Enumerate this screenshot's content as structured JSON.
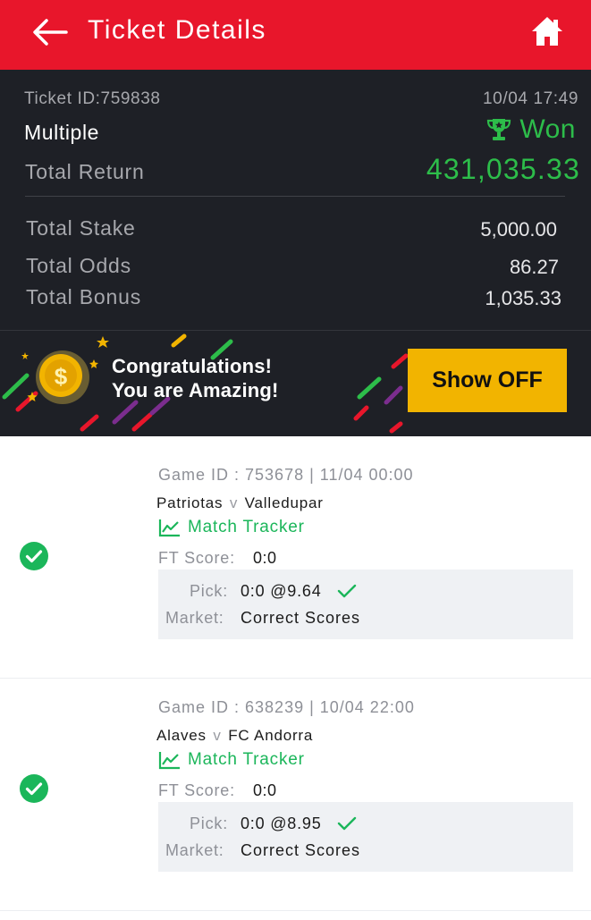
{
  "header": {
    "title": "Ticket Details",
    "back_icon": "arrow-left-icon",
    "home_icon": "home-icon",
    "background_color": "#e8162b"
  },
  "ticket": {
    "id_label": "Ticket ID:759838",
    "datetime": "10/04 17:49",
    "bet_type": "Multiple",
    "status": "Won",
    "status_icon": "trophy-icon",
    "status_color": "#2dbd4a",
    "total_return_label": "Total Return",
    "total_return": "431,035.33",
    "rows": [
      {
        "label": "Total Stake",
        "value": "5,000.00"
      },
      {
        "label": "Total Odds",
        "value": "86.27"
      },
      {
        "label": "Total Bonus",
        "value": "1,035.33"
      }
    ]
  },
  "banner": {
    "line1": "Congratulations!",
    "line2": "You are Amazing!",
    "coin_icon": "gold-coin-icon",
    "button_label": "Show OFF",
    "button_color": "#f2b400"
  },
  "games": [
    {
      "meta": "Game ID : 753678 | 11/04 00:00",
      "home": "Patriotas",
      "vs": "v",
      "away": "Valledupar",
      "tracker_label": "Match Tracker",
      "ft_label": "FT Score:",
      "ft_score": "0:0",
      "pick_label": "Pick:",
      "pick_value": "0:0 @9.64",
      "market_label": "Market:",
      "market_value": "Correct Scores",
      "result_icon": "check-circle-icon"
    },
    {
      "meta": "Game ID : 638239 | 10/04 22:00",
      "home": "Alaves",
      "vs": "v",
      "away": "FC Andorra",
      "tracker_label": "Match Tracker",
      "ft_label": "FT Score:",
      "ft_score": "0:0",
      "pick_label": "Pick:",
      "pick_value": "0:0 @8.95",
      "market_label": "Market:",
      "market_value": "Correct Scores",
      "result_icon": "check-circle-icon"
    }
  ]
}
